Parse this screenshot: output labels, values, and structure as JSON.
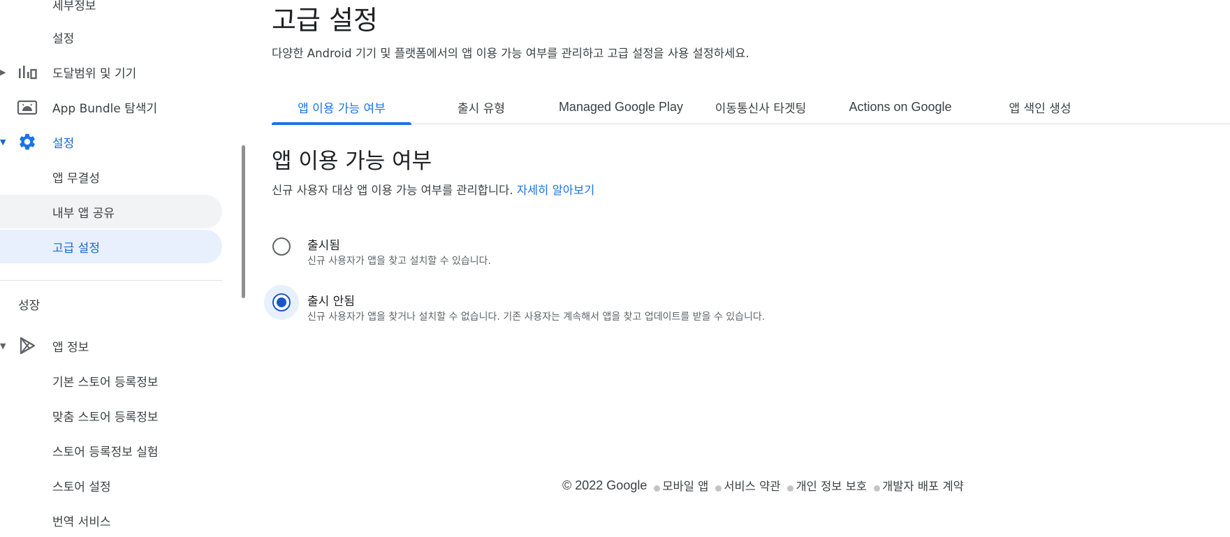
{
  "sidebar": {
    "items": [
      {
        "label": "세부정보"
      },
      {
        "label": "설정"
      },
      {
        "label": "도달범위 및 기기",
        "icon": "bar-chart-icon"
      },
      {
        "label": "App Bundle 탐색기",
        "icon": "android-icon"
      },
      {
        "label": "설정",
        "icon": "gear-icon"
      },
      {
        "label": "앱 무결성"
      },
      {
        "label": "내부 앱 공유"
      },
      {
        "label": "고급 설정"
      },
      {
        "label": "성장"
      },
      {
        "label": "앱 정보",
        "icon": "play-icon"
      },
      {
        "label": "기본 스토어 등록정보"
      },
      {
        "label": "맞춤 스토어 등록정보"
      },
      {
        "label": "스토어 등록정보 실험"
      },
      {
        "label": "스토어 설정"
      },
      {
        "label": "번역 서비스"
      }
    ]
  },
  "header": {
    "title": "고급 설정",
    "description": "다양한 Android 기기 및 플랫폼에서의 앱 이용 가능 여부를 관리하고 고급 설정을 사용 설정하세요."
  },
  "tabs": [
    {
      "label": "앱 이용 가능 여부",
      "active": true
    },
    {
      "label": "출시 유형"
    },
    {
      "label": "Managed Google Play"
    },
    {
      "label": "이동통신사 타겟팅"
    },
    {
      "label": "Actions on Google"
    },
    {
      "label": "앱 색인 생성"
    }
  ],
  "section": {
    "title": "앱 이용 가능 여부",
    "description": "신규 사용자 대상 앱 이용 가능 여부를 관리합니다.",
    "learn_more": "자세히 알아보기"
  },
  "options": [
    {
      "label": "출시됨",
      "help": "신규 사용자가 앱을 찾고 설치할 수 있습니다.",
      "checked": false
    },
    {
      "label": "출시 안됨",
      "help": "신규 사용자가 앱을 찾거나 설치할 수 없습니다. 기존 사용자는 계속해서 앱을 찾고 업데이트를 받을 수 있습니다.",
      "checked": true
    }
  ],
  "footer": {
    "copyright": "© 2022 Google",
    "links": [
      "모바일 앱",
      "서비스 약관",
      "개인 정보 보호",
      "개발자 배포 계약"
    ]
  },
  "colors": {
    "accent": "#1a73e8",
    "selected_bg": "#e8f0fe",
    "hover_bg": "#f1f3f4"
  }
}
